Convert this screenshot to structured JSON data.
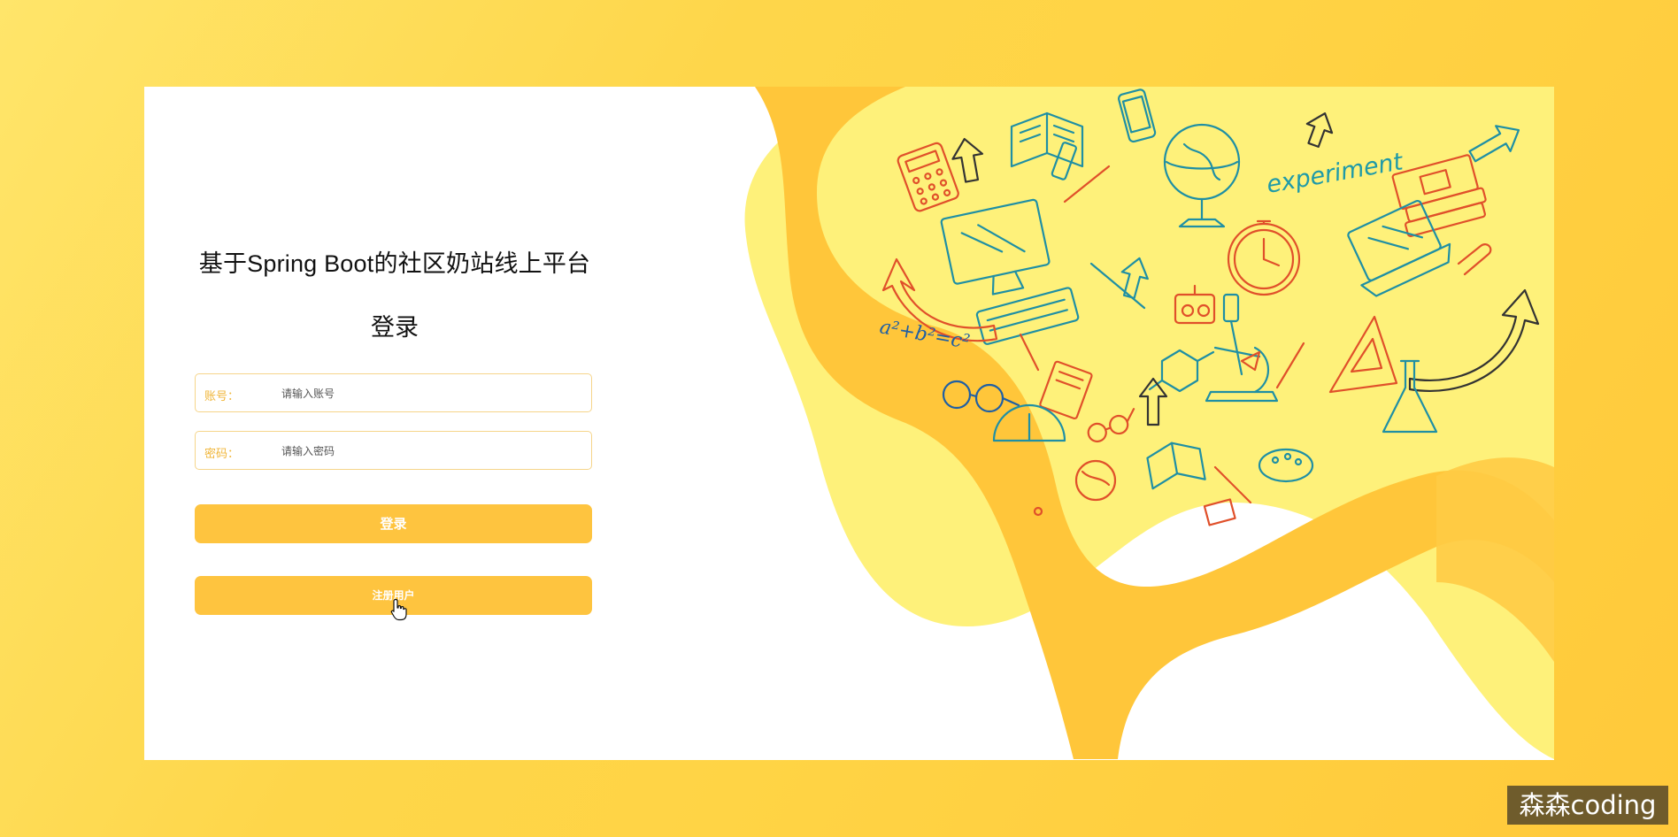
{
  "header": {
    "site_title": "基于Spring Boot的社区奶站线上平台",
    "login_heading": "登录"
  },
  "form": {
    "account_label": "账号：",
    "account_placeholder": "请输入账号",
    "password_label": "密码：",
    "password_placeholder": "请输入密码",
    "login_button": "登录",
    "register_button": "注册用户"
  },
  "illustration": {
    "formula_text": "a²+b²=c²",
    "experiment_text": "experiment"
  },
  "watermark": "森森coding",
  "colors": {
    "accent": "#fec43f",
    "background": "#ffd84f",
    "field_border": "#f6d58a",
    "label": "#f0b63a"
  }
}
